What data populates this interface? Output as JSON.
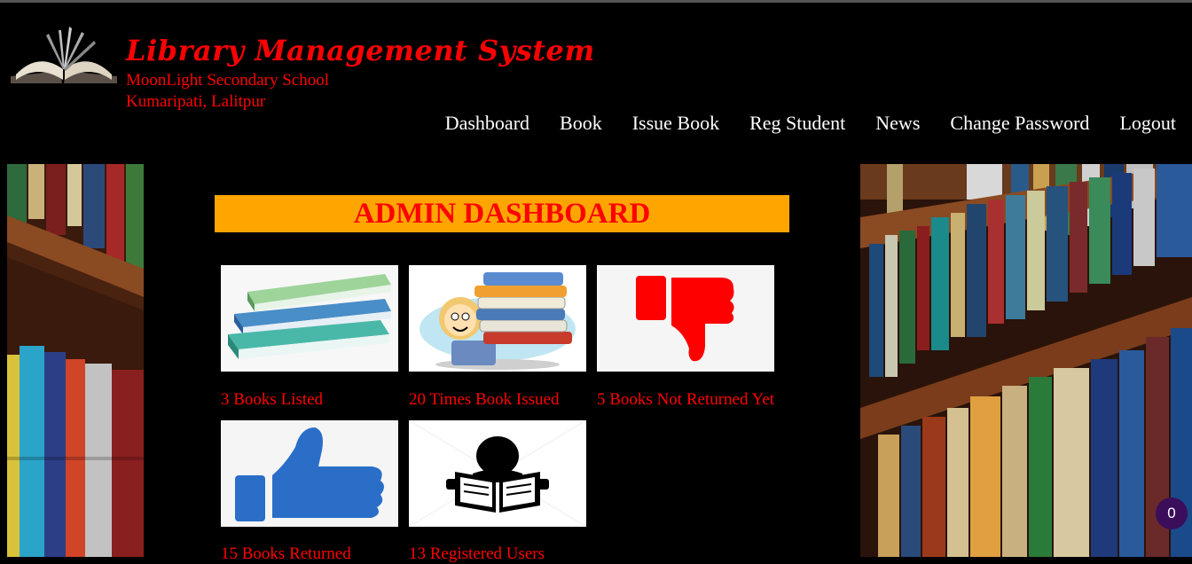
{
  "header": {
    "title": "Library Management System",
    "school_name": "MoonLight Secondary School",
    "school_address": "Kumaripati, Lalitpur"
  },
  "nav": {
    "items": [
      {
        "label": "Dashboard"
      },
      {
        "label": "Book"
      },
      {
        "label": "Issue Book"
      },
      {
        "label": "Reg Student"
      },
      {
        "label": "News"
      },
      {
        "label": "Change Password"
      },
      {
        "label": "Logout"
      }
    ]
  },
  "dashboard": {
    "heading": "ADMIN DASHBOARD",
    "cards": [
      {
        "label": "3 Books Listed",
        "icon": "books-stack-icon"
      },
      {
        "label": "20 Times Book Issued",
        "icon": "student-carrying-books-icon"
      },
      {
        "label": "5 Books Not Returned Yet",
        "icon": "thumbs-down-icon"
      },
      {
        "label": "15 Books Returned",
        "icon": "thumbs-up-icon"
      },
      {
        "label": "13 Registered Users",
        "icon": "reader-icon"
      }
    ]
  },
  "notification_badge": {
    "count": "0"
  },
  "colors": {
    "accent": "#ff0000",
    "banner": "#ffa500",
    "background": "#000000",
    "nav_text": "#ffffff"
  }
}
